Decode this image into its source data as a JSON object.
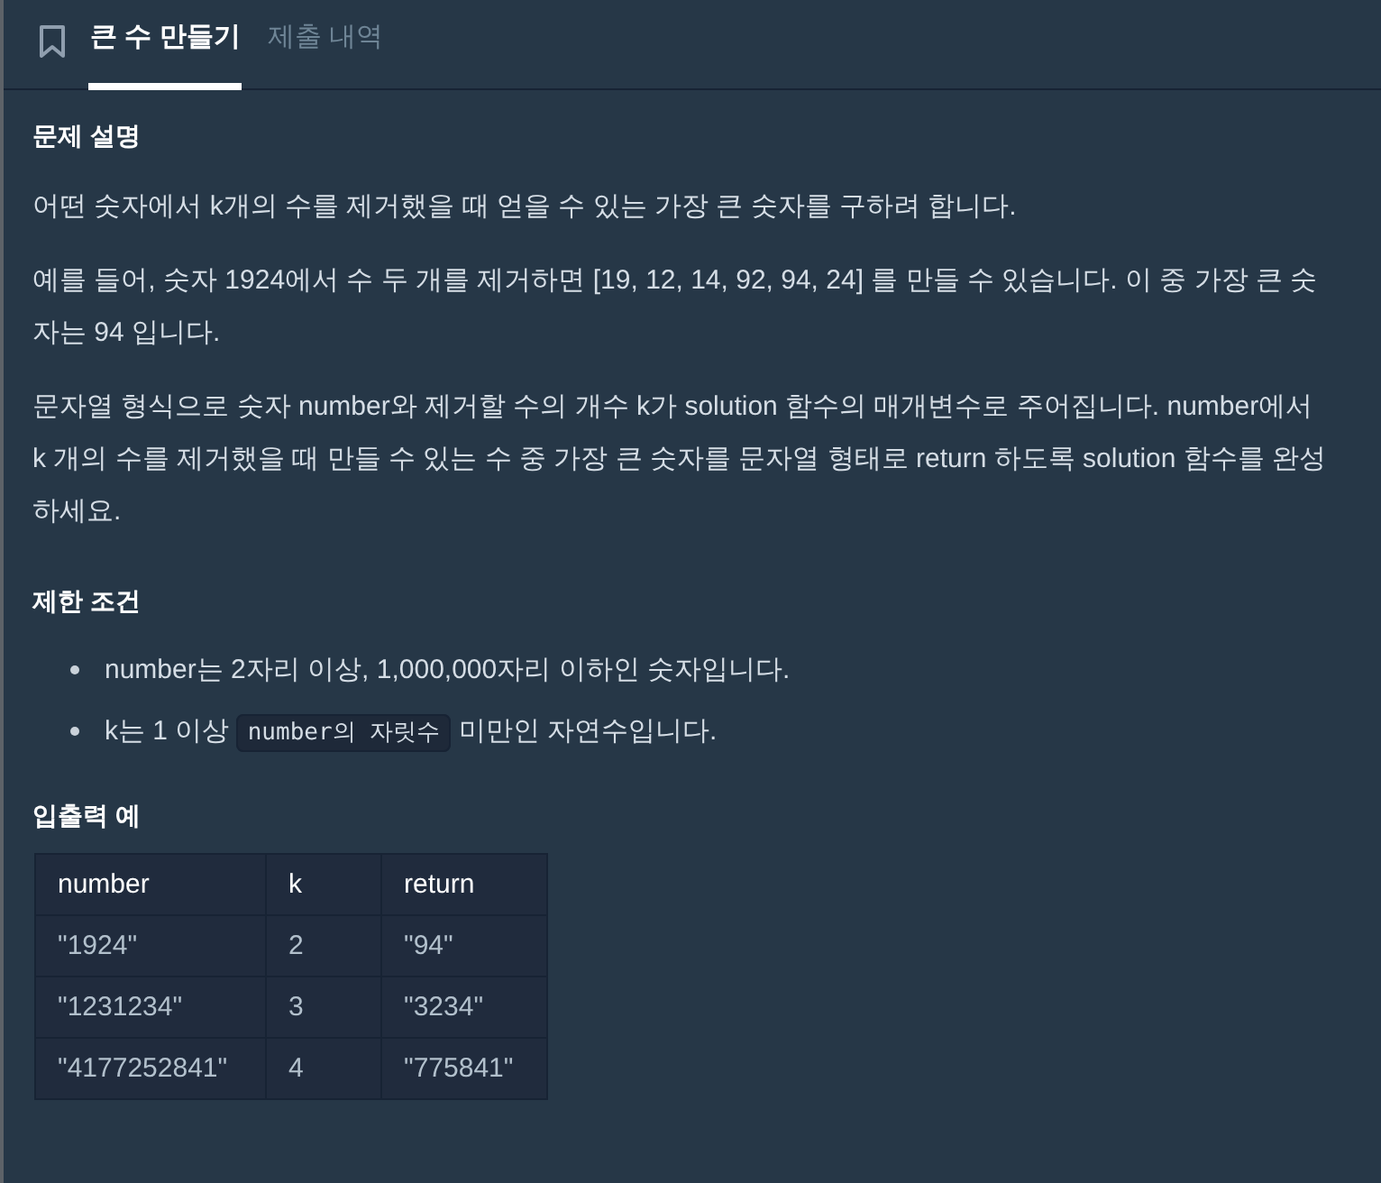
{
  "tabs": [
    {
      "label": "큰 수 만들기",
      "selected": true
    },
    {
      "label": "제출 내역",
      "selected": false
    }
  ],
  "description": {
    "heading": "문제 설명",
    "paragraphs": [
      "어떤 숫자에서 k개의 수를 제거했을 때 얻을 수 있는 가장 큰 숫자를 구하려 합니다.",
      "예를 들어, 숫자 1924에서 수 두 개를 제거하면 [19, 12, 14, 92, 94, 24] 를 만들 수 있습니다. 이 중 가장 큰 숫자는 94 입니다.",
      "문자열 형식으로 숫자 number와 제거할 수의 개수 k가 solution 함수의 매개변수로 주어집니다. number에서 k 개의 수를 제거했을 때 만들 수 있는 수 중 가장 큰 숫자를 문자열 형태로 return 하도록 solution 함수를 완성하세요."
    ]
  },
  "constraints": {
    "heading": "제한 조건",
    "items": [
      {
        "parts": [
          {
            "kind": "text",
            "text": "number는 2자리 이상, 1,000,000자리 이하인 숫자입니다."
          }
        ]
      },
      {
        "parts": [
          {
            "kind": "text",
            "text": "k는 1 이상"
          },
          {
            "kind": "code",
            "text": "number의 자릿수"
          },
          {
            "kind": "text",
            "text": "미만인 자연수입니다."
          }
        ]
      }
    ]
  },
  "examples": {
    "heading": "입출력 예",
    "table": {
      "columns": [
        "number",
        "k",
        "return"
      ],
      "rows": [
        [
          "\"1924\"",
          "2",
          "\"94\""
        ],
        [
          "\"1231234\"",
          "3",
          "\"3234\""
        ],
        [
          "\"4177252841\"",
          "4",
          "\"775841\""
        ]
      ]
    }
  }
}
